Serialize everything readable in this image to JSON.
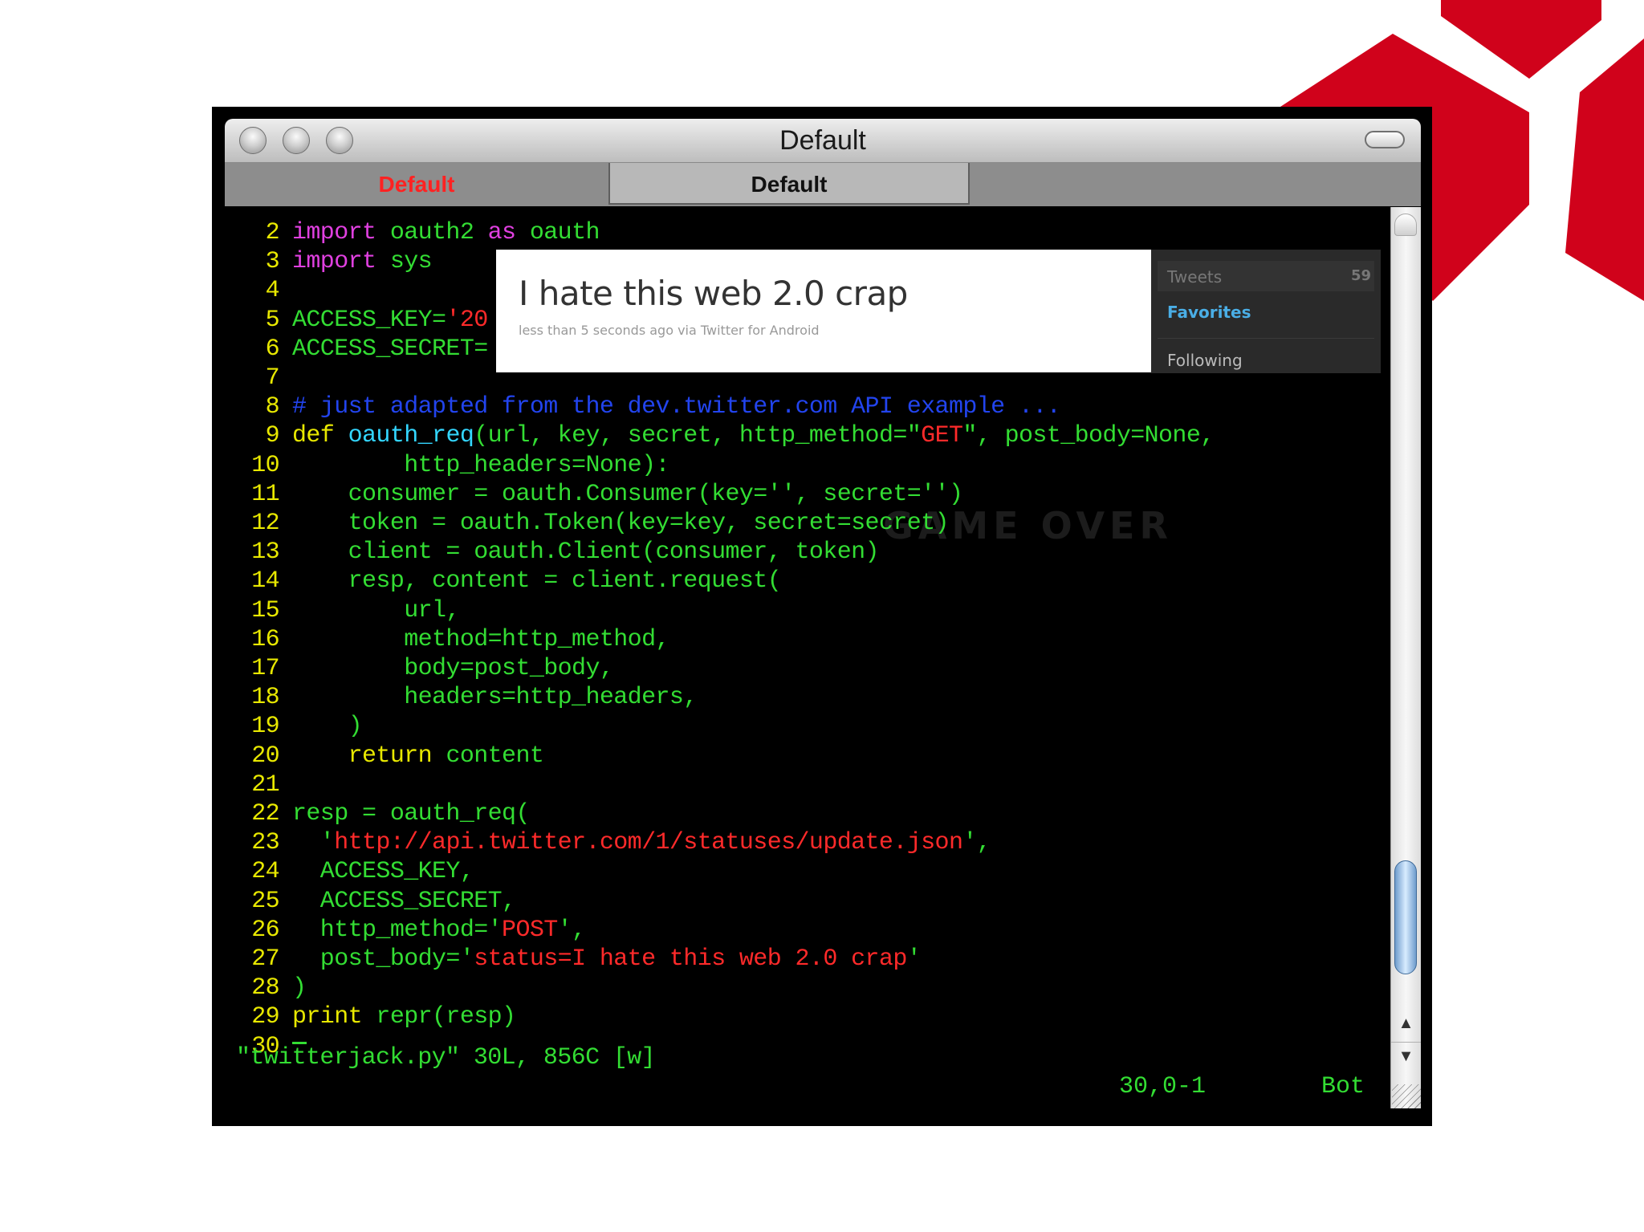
{
  "window": {
    "title": "Default",
    "tabs": [
      {
        "label": "Default",
        "active": false
      },
      {
        "label": "Default",
        "active": true
      }
    ]
  },
  "editor": {
    "lines": [
      {
        "n": "2",
        "parts": [
          {
            "t": "import",
            "c": "kw"
          },
          {
            "t": " oauth2 ",
            "c": "grn"
          },
          {
            "t": "as",
            "c": "kw"
          },
          {
            "t": " oauth",
            "c": "grn"
          }
        ]
      },
      {
        "n": "3",
        "parts": [
          {
            "t": "import",
            "c": "kw"
          },
          {
            "t": " sys",
            "c": "grn"
          }
        ]
      },
      {
        "n": "4",
        "parts": []
      },
      {
        "n": "5",
        "parts": [
          {
            "t": "ACCESS_KEY=",
            "c": "grn"
          },
          {
            "t": "'20",
            "c": "str"
          }
        ]
      },
      {
        "n": "6",
        "parts": [
          {
            "t": "ACCESS_SECRET=",
            "c": "grn"
          }
        ]
      },
      {
        "n": "7",
        "parts": []
      },
      {
        "n": "8",
        "parts": [
          {
            "t": "# just adapted from the dev.twitter.com API example ...",
            "c": "cmt"
          }
        ]
      },
      {
        "n": "9",
        "parts": [
          {
            "t": "def",
            "c": "def"
          },
          {
            "t": " ",
            "c": "grn"
          },
          {
            "t": "oauth_req",
            "c": "fn"
          },
          {
            "t": "(url, key, secret, http_method=\"",
            "c": "grn"
          },
          {
            "t": "GET",
            "c": "str"
          },
          {
            "t": "\", post_body=None,",
            "c": "grn"
          }
        ]
      },
      {
        "n": "10",
        "parts": [
          {
            "t": "        http_headers=None):",
            "c": "grn"
          }
        ]
      },
      {
        "n": "11",
        "parts": [
          {
            "t": "    consumer = oauth.Consumer(key='', secret='')",
            "c": "grn"
          }
        ]
      },
      {
        "n": "12",
        "parts": [
          {
            "t": "    token = oauth.Token(key=key, secret=secret)",
            "c": "grn"
          }
        ]
      },
      {
        "n": "13",
        "parts": [
          {
            "t": "    client = oauth.Client(consumer, token)",
            "c": "grn"
          }
        ]
      },
      {
        "n": "14",
        "parts": [
          {
            "t": "    resp, content = client.request(",
            "c": "grn"
          }
        ]
      },
      {
        "n": "15",
        "parts": [
          {
            "t": "        url,",
            "c": "grn"
          }
        ]
      },
      {
        "n": "16",
        "parts": [
          {
            "t": "        method=http_method,",
            "c": "grn"
          }
        ]
      },
      {
        "n": "17",
        "parts": [
          {
            "t": "        body=post_body,",
            "c": "grn"
          }
        ]
      },
      {
        "n": "18",
        "parts": [
          {
            "t": "        headers=http_headers,",
            "c": "grn"
          }
        ]
      },
      {
        "n": "19",
        "parts": [
          {
            "t": "    )",
            "c": "grn"
          }
        ]
      },
      {
        "n": "20",
        "parts": [
          {
            "t": "    ",
            "c": "grn"
          },
          {
            "t": "return",
            "c": "def"
          },
          {
            "t": " content",
            "c": "grn"
          }
        ]
      },
      {
        "n": "21",
        "parts": []
      },
      {
        "n": "22",
        "parts": [
          {
            "t": "resp = oauth_req(",
            "c": "grn"
          }
        ]
      },
      {
        "n": "23",
        "parts": [
          {
            "t": "  '",
            "c": "grn"
          },
          {
            "t": "http://api.twitter.com/1/statuses/update.json",
            "c": "str"
          },
          {
            "t": "',",
            "c": "grn"
          }
        ]
      },
      {
        "n": "24",
        "parts": [
          {
            "t": "  ACCESS_KEY,",
            "c": "grn"
          }
        ]
      },
      {
        "n": "25",
        "parts": [
          {
            "t": "  ACCESS_SECRET,",
            "c": "grn"
          }
        ]
      },
      {
        "n": "26",
        "parts": [
          {
            "t": "  http_method='",
            "c": "grn"
          },
          {
            "t": "POST",
            "c": "str"
          },
          {
            "t": "',",
            "c": "grn"
          }
        ]
      },
      {
        "n": "27",
        "parts": [
          {
            "t": "  post_body='",
            "c": "grn"
          },
          {
            "t": "status=I hate this web 2.0 crap",
            "c": "str"
          },
          {
            "t": "'",
            "c": "grn"
          }
        ]
      },
      {
        "n": "28",
        "parts": [
          {
            "t": ")",
            "c": "grn"
          }
        ]
      },
      {
        "n": "29",
        "parts": [
          {
            "t": "print",
            "c": "def"
          },
          {
            "t": " repr(resp)",
            "c": "grn"
          }
        ]
      },
      {
        "n": "30",
        "parts": []
      }
    ],
    "status_message": "\"twitterjack.py\" 30L, 856C [w]",
    "cursor_position": "30,0-1",
    "scroll_position": "Bot",
    "overlay_text": "GAME OVER"
  },
  "tweet": {
    "text": "I hate this web 2.0 crap",
    "meta": "less than 5 seconds ago via Twitter for Android"
  },
  "twitter_sidebar": {
    "tweets_label": "Tweets",
    "tweets_count": "59",
    "favorites_label": "Favorites",
    "following_label": "Following"
  },
  "scrollbar": {
    "up_arrow": "▲",
    "down_arrow": "▼"
  },
  "colors": {
    "logo_red": "#d0021b",
    "code_green": "#33dd33",
    "line_number_yellow": "#e8e800",
    "keyword_magenta": "#e040e0",
    "string_red": "#ff2a2a",
    "comment_blue": "#2244ee",
    "function_cyan": "#33d6ff"
  }
}
